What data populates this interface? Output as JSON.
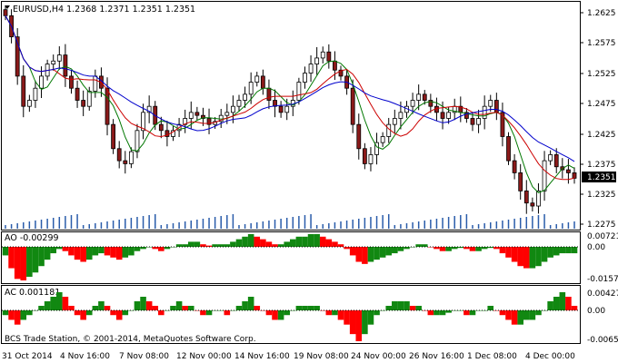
{
  "window": {
    "symbol_header": "EURUSD,H4  1.2368  1.2371  1.2351  1.2351",
    "triangle_icon": "menu-triangle-icon"
  },
  "price_panel": {
    "current_price_label": "1.2351",
    "y_ticks": [
      "1.2625",
      "1.2575",
      "1.2525",
      "1.2475",
      "1.2425",
      "1.2375",
      "1.2325",
      "1.2275"
    ]
  },
  "ao_panel": {
    "label": "AO -0.00299",
    "y_ticks": [
      "0.00721",
      "0.00",
      "-0.01571"
    ]
  },
  "ac_panel": {
    "label": "AC 0.001181",
    "y_ticks": [
      "0.004272",
      "0.00",
      "-0.00651"
    ]
  },
  "footer": {
    "copyright": "BCS Trade Station, © 2001-2014, MetaQuotes Software Corp."
  },
  "time_axis": {
    "labels": [
      "31 Oct 2014",
      "4 Nov 16:00",
      "7 Nov 08:00",
      "12 Nov 00:00",
      "14 Nov 16:00",
      "19 Nov 08:00",
      "24 Nov 00:00",
      "26 Nov 16:00",
      "1 Dec 08:00",
      "4 Dec 00:00"
    ]
  },
  "colors": {
    "bull_candle": "#ffffff",
    "bear_candle": "#8b1a1a",
    "ma_slow": "#0000cc",
    "ma_mid": "#cc0000",
    "ma_fast": "#007700",
    "osc_up": "#118811",
    "osc_down": "#ff0000",
    "grid": "#000000"
  },
  "chart_data": {
    "type": "line",
    "title": "EURUSD,H4",
    "ohlc_last": {
      "open": 1.2368,
      "high": 1.2371,
      "low": 1.2351,
      "close": 1.2351
    },
    "ylim": [
      1.2275,
      1.264
    ],
    "close_series": [
      1.262,
      1.2585,
      1.252,
      1.247,
      1.248,
      1.25,
      1.252,
      1.254,
      1.2545,
      1.2555,
      1.252,
      1.25,
      1.248,
      1.247,
      1.2495,
      1.252,
      1.25,
      1.244,
      1.24,
      1.238,
      1.2375,
      1.2395,
      1.243,
      1.246,
      1.247,
      1.244,
      1.243,
      1.242,
      1.243,
      1.244,
      1.245,
      1.246,
      1.2455,
      1.245,
      1.244,
      1.2445,
      1.2455,
      1.246,
      1.247,
      1.248,
      1.249,
      1.251,
      1.252,
      1.25,
      1.248,
      1.247,
      1.246,
      1.247,
      1.248,
      1.251,
      1.2525,
      1.254,
      1.255,
      1.256,
      1.2545,
      1.253,
      1.252,
      1.25,
      1.244,
      1.24,
      1.2375,
      1.239,
      1.241,
      1.242,
      1.244,
      1.245,
      1.246,
      1.247,
      1.248,
      1.249,
      1.248,
      1.247,
      1.246,
      1.245,
      1.246,
      1.247,
      1.246,
      1.245,
      1.244,
      1.245,
      1.247,
      1.248,
      1.246,
      1.242,
      1.238,
      1.236,
      1.233,
      1.231,
      1.2305,
      1.233,
      1.238,
      1.239,
      1.237,
      1.2365,
      1.236,
      1.2351
    ],
    "ao": [
      -0.004,
      -0.01,
      -0.015,
      -0.0157,
      -0.014,
      -0.012,
      -0.009,
      -0.006,
      -0.003,
      -0.001,
      -0.002,
      -0.004,
      -0.006,
      -0.007,
      -0.006,
      -0.004,
      -0.003,
      -0.004,
      -0.005,
      -0.006,
      -0.005,
      -0.004,
      -0.002,
      -0.001,
      0.0,
      -0.001,
      -0.002,
      -0.001,
      0.0,
      0.001,
      0.001,
      0.002,
      0.002,
      0.001,
      0.0005,
      0.001,
      0.001,
      0.001,
      0.002,
      0.003,
      0.004,
      0.005,
      0.004,
      0.003,
      0.002,
      0.001,
      0.001,
      0.002,
      0.003,
      0.004,
      0.004,
      0.005,
      0.005,
      0.004,
      0.003,
      0.002,
      0.001,
      -0.001,
      -0.004,
      -0.007,
      -0.008,
      -0.007,
      -0.006,
      -0.005,
      -0.004,
      -0.003,
      -0.002,
      -0.001,
      0.0,
      0.001,
      0.001,
      0.0,
      -0.001,
      -0.002,
      -0.002,
      -0.001,
      -0.0005,
      -0.001,
      -0.002,
      -0.002,
      -0.001,
      -0.0005,
      -0.001,
      -0.003,
      -0.005,
      -0.007,
      -0.009,
      -0.01,
      -0.01,
      -0.009,
      -0.007,
      -0.005,
      -0.004,
      -0.003,
      -0.003,
      -0.003
    ],
    "ac": [
      -0.001,
      -0.002,
      -0.003,
      -0.002,
      -0.001,
      0.0,
      0.001,
      0.002,
      0.003,
      0.004,
      0.003,
      0.001,
      -0.001,
      -0.002,
      -0.001,
      0.001,
      0.002,
      0.001,
      -0.001,
      -0.002,
      -0.001,
      0.0,
      0.002,
      0.003,
      0.002,
      0.001,
      -0.001,
      0.0,
      0.001,
      0.002,
      0.001,
      0.001,
      0.0,
      -0.001,
      -0.001,
      0.0,
      0.0,
      -0.001,
      0.0,
      0.001,
      0.002,
      0.003,
      0.001,
      0.0,
      -0.001,
      -0.002,
      -0.002,
      -0.001,
      0.0,
      0.001,
      0.001,
      0.001,
      0.001,
      0.0,
      -0.001,
      -0.001,
      -0.002,
      -0.003,
      -0.005,
      -0.0065,
      -0.005,
      -0.003,
      -0.001,
      0.0,
      0.001,
      0.002,
      0.002,
      0.002,
      0.001,
      0.001,
      0.0,
      -0.001,
      -0.001,
      -0.001,
      -0.0005,
      0.0,
      0.0,
      -0.001,
      -0.001,
      0.0,
      0.0,
      0.001,
      0.0,
      -0.001,
      -0.002,
      -0.003,
      -0.003,
      -0.002,
      -0.002,
      -0.001,
      0.0,
      0.002,
      0.003,
      0.004,
      0.003,
      0.001
    ]
  }
}
